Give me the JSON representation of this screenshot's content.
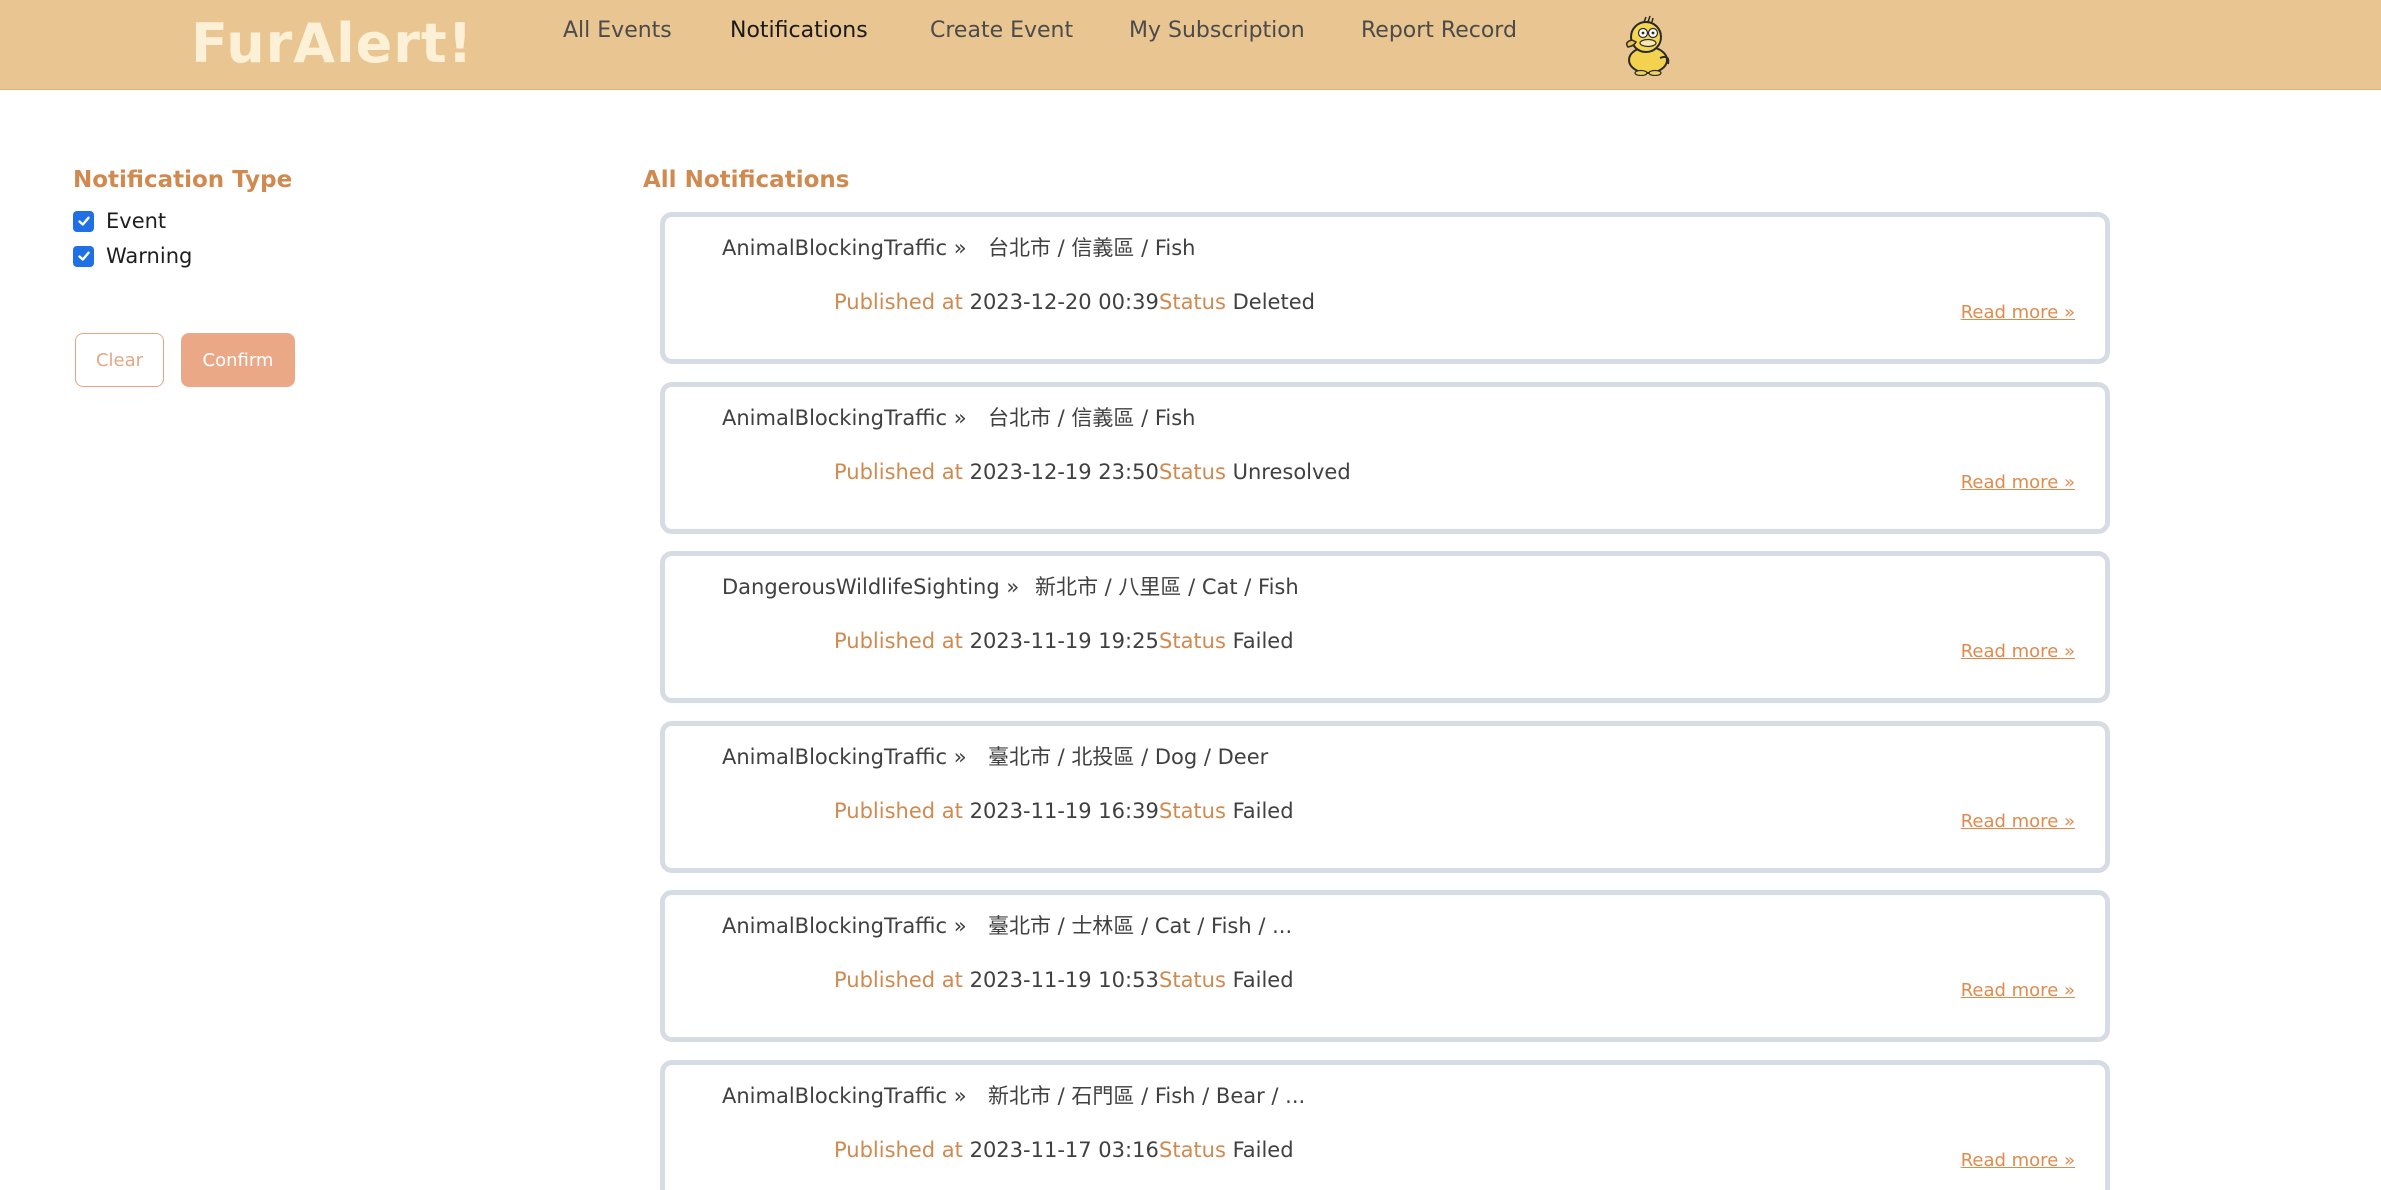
{
  "navbar": {
    "brand": "FurAlert!",
    "links": [
      "All Events",
      "Notifications",
      "Create Event",
      "My Subscription",
      "Report Record"
    ],
    "active": "Notifications"
  },
  "sidebar": {
    "title": "Notification Type",
    "filters": [
      {
        "label": "Event",
        "checked": true
      },
      {
        "label": "Warning",
        "checked": true
      }
    ],
    "clear_label": "Clear",
    "confirm_label": "Confirm"
  },
  "main": {
    "title": "All Notifications",
    "published_label": "Published at",
    "status_label": "Status",
    "read_more_label": "Read more »",
    "notifications": [
      {
        "type": "AnimalBlockingTraffic »",
        "location": "台北市 / 信義區 / Fish",
        "published": "2023-12-20 00:39",
        "status": "Deleted"
      },
      {
        "type": "AnimalBlockingTraffic »",
        "location": "台北市 / 信義區 / Fish",
        "published": "2023-12-19 23:50",
        "status": "Unresolved"
      },
      {
        "type": "DangerousWildlifeSighting »",
        "location": "新北市 / 八里區 / Cat / Fish",
        "published": "2023-11-19 19:25",
        "status": "Failed"
      },
      {
        "type": "AnimalBlockingTraffic »",
        "location": "臺北市 / 北投區 / Dog / Deer",
        "published": "2023-11-19 16:39",
        "status": "Failed"
      },
      {
        "type": "AnimalBlockingTraffic »",
        "location": "臺北市 / 士林區 / Cat / Fish / ...",
        "published": "2023-11-19 10:53",
        "status": "Failed"
      },
      {
        "type": "AnimalBlockingTraffic »",
        "location": "新北市 / 石門區 / Fish / Bear / ...",
        "published": "2023-11-17 03:16",
        "status": "Failed"
      }
    ]
  },
  "colors": {
    "navbar_bg": "#e8c591",
    "brand": "#fcf0d6",
    "accent": "#d0894f",
    "checkbox": "#1f6fe5",
    "card_border": "#d7dce4",
    "confirm_bg": "#eba886"
  },
  "icons": {
    "avatar": "duck-mascot-icon",
    "checkbox": "check-icon"
  }
}
